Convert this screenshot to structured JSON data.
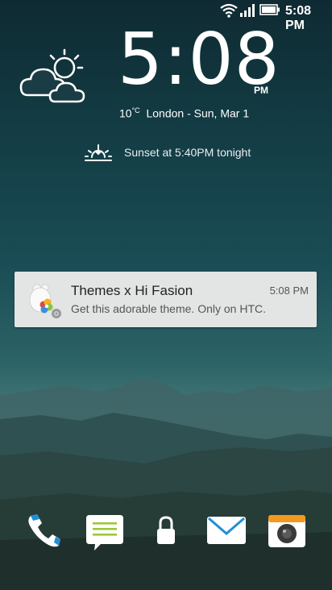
{
  "status_bar": {
    "time": "5:08 PM",
    "icons": [
      "wifi-icon",
      "signal-icon",
      "battery-icon"
    ]
  },
  "clock": {
    "time": "5:08",
    "ampm": "PM",
    "temp": "10",
    "temp_unit": "°C",
    "location_date": "London - Sun, Mar 1",
    "weather_icon": "partly-cloudy-icon"
  },
  "sunset": {
    "text": "Sunset at 5:40PM tonight",
    "icon": "sunset-icon"
  },
  "notification": {
    "title": "Themes x Hi Fasion",
    "time": "5:08 PM",
    "body": "Get this adorable theme. Only on HTC.",
    "icon": "themes-app-icon"
  },
  "dock": {
    "items": [
      {
        "name": "phone-icon"
      },
      {
        "name": "messages-icon"
      },
      {
        "name": "lock-icon"
      },
      {
        "name": "mail-icon"
      },
      {
        "name": "camera-icon"
      }
    ]
  },
  "colors": {
    "notification_bg": "#e3e4e4",
    "mail_blue": "#1f8fd6",
    "messages_green": "#9cc63b",
    "camera_orange": "#f39a1e"
  }
}
